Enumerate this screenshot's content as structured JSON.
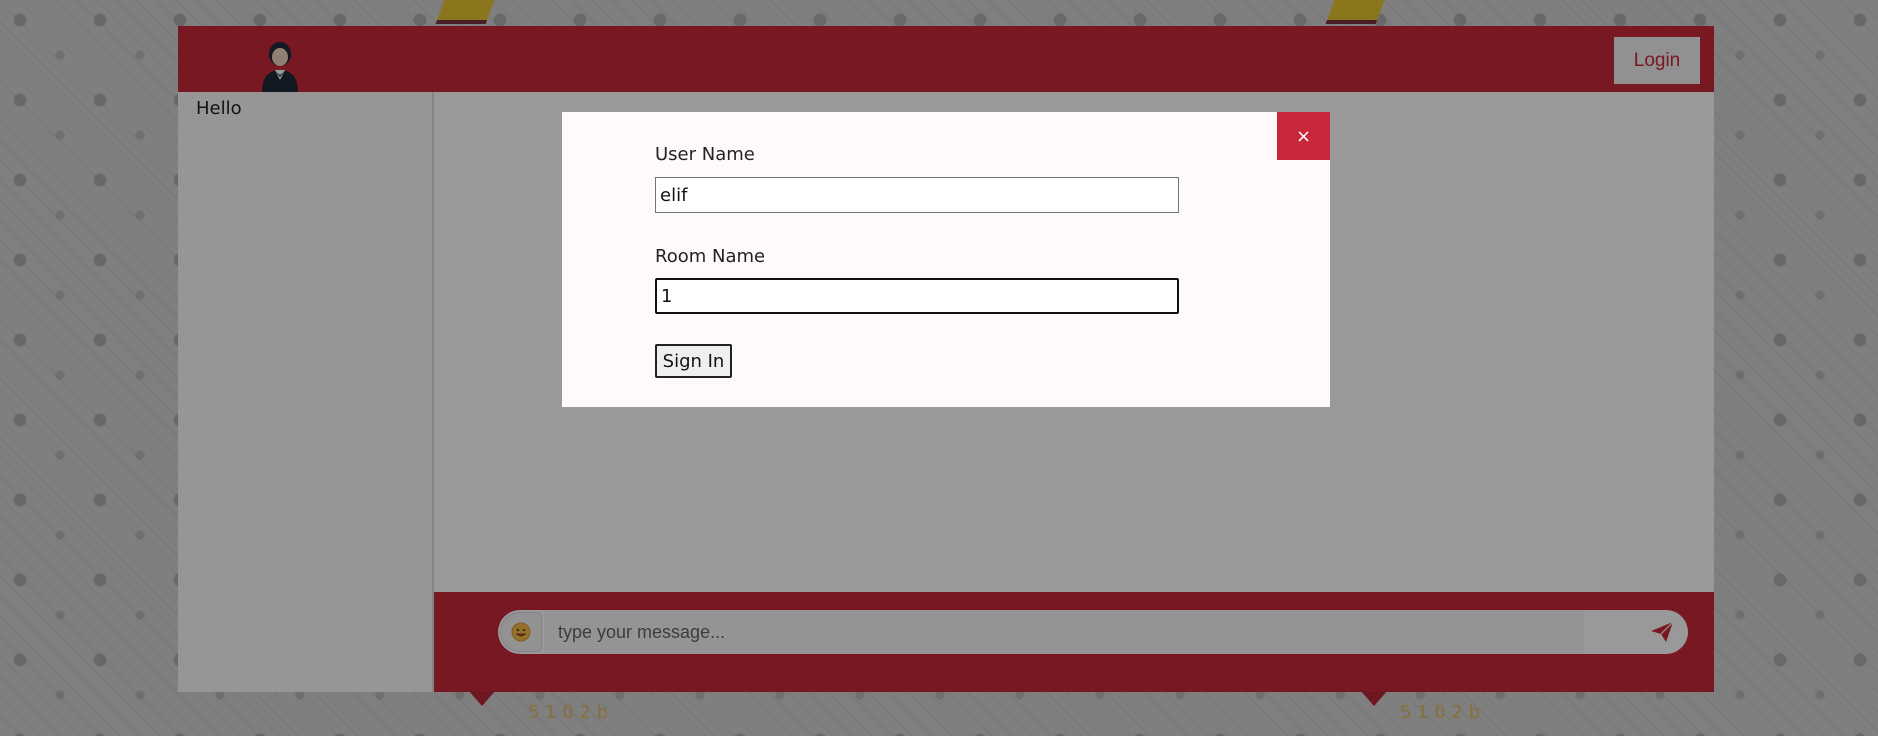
{
  "header": {
    "login_label": "Login"
  },
  "sidebar": {
    "greeting": "Hello"
  },
  "composer": {
    "placeholder": "type your message...",
    "emoji_icon": "emoji-icon",
    "send_icon": "paper-plane-icon"
  },
  "modal": {
    "close_label": "×",
    "username_label": "User Name",
    "username_value": "elif",
    "room_label": "Room Name",
    "room_value": "1",
    "signin_label": "Sign In"
  },
  "colors": {
    "brand": "#c8283b",
    "modal_bg": "#fefaf9"
  }
}
